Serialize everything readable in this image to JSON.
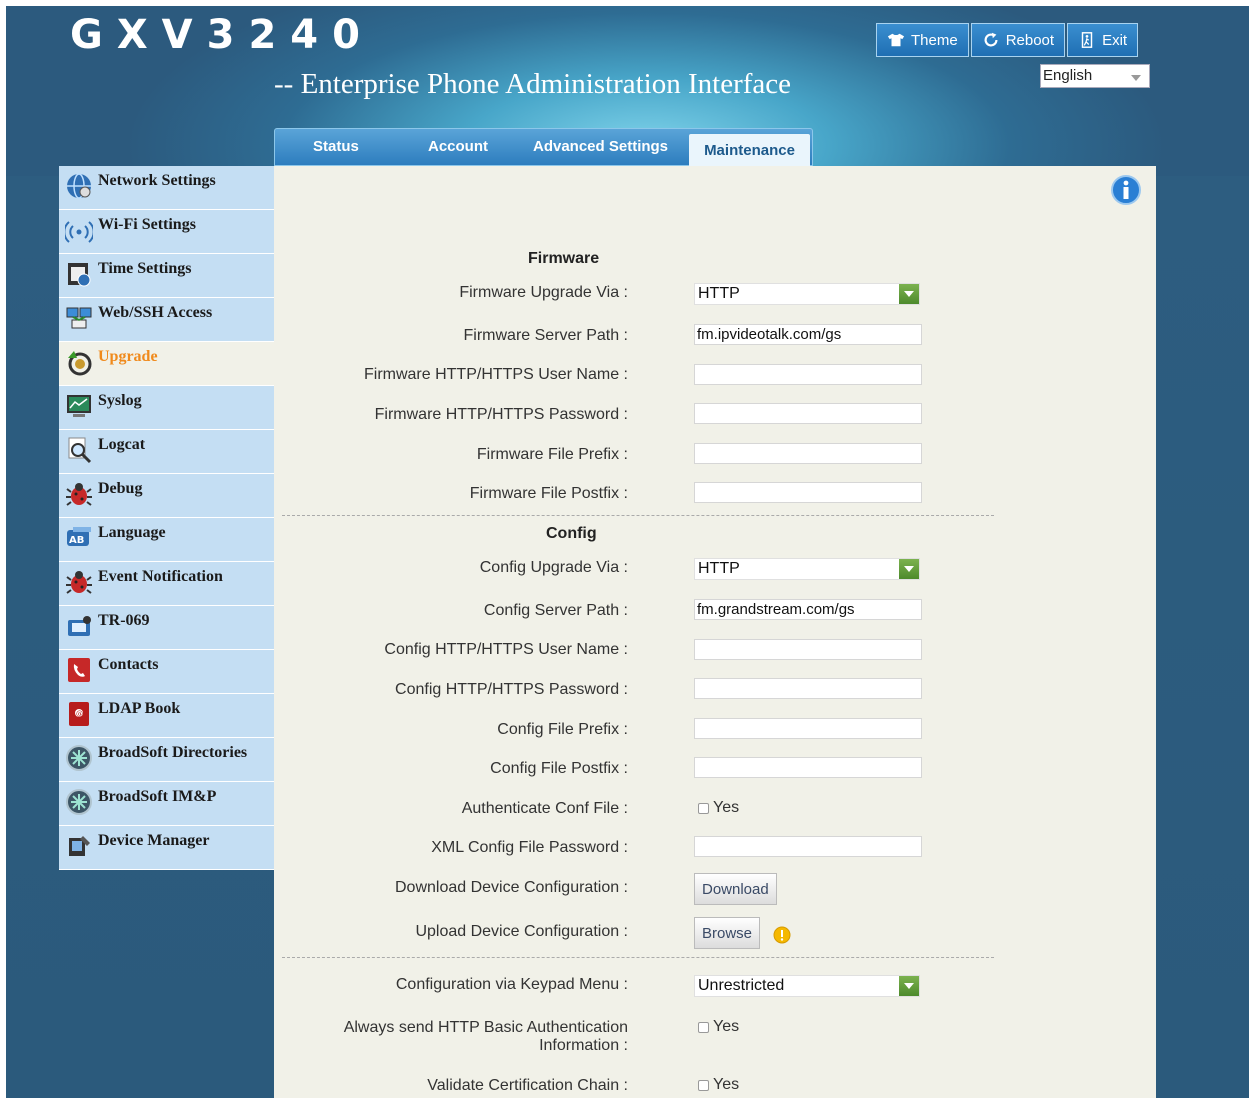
{
  "header": {
    "logo": "GXV3240",
    "subtitle": "-- Enterprise Phone Administration Interface",
    "buttons": {
      "theme": "Theme",
      "reboot": "Reboot",
      "exit": "Exit"
    },
    "language": "English"
  },
  "tabs": [
    "Status",
    "Account",
    "Advanced Settings",
    "Maintenance"
  ],
  "sidebar": [
    {
      "label": "Network Settings",
      "icon": "globe-icon"
    },
    {
      "label": "Wi-Fi Settings",
      "icon": "wifi-icon"
    },
    {
      "label": "Time Settings",
      "icon": "calendar-clock-icon"
    },
    {
      "label": "Web/SSH Access",
      "icon": "network-computers-icon"
    },
    {
      "label": "Upgrade",
      "icon": "upgrade-arrow-icon"
    },
    {
      "label": "Syslog",
      "icon": "monitor-chart-icon"
    },
    {
      "label": "Logcat",
      "icon": "magnifier-document-icon"
    },
    {
      "label": "Debug",
      "icon": "bug-icon"
    },
    {
      "label": "Language",
      "icon": "language-ab-icon"
    },
    {
      "label": "Event Notification",
      "icon": "bug-icon"
    },
    {
      "label": "TR-069",
      "icon": "tr069-device-icon"
    },
    {
      "label": "Contacts",
      "icon": "phone-book-icon"
    },
    {
      "label": "LDAP Book",
      "icon": "ldap-book-icon"
    },
    {
      "label": "BroadSoft Directories",
      "icon": "broadsoft-icon"
    },
    {
      "label": "BroadSoft IM&P",
      "icon": "broadsoft-icon"
    },
    {
      "label": "Device Manager",
      "icon": "device-manager-icon"
    }
  ],
  "firmware": {
    "title": "Firmware",
    "upgrade_via_label": "Firmware Upgrade Via :",
    "upgrade_via_value": "HTTP",
    "server_path_label": "Firmware Server Path :",
    "server_path_value": "fm.ipvideotalk.com/gs",
    "user_label": "Firmware HTTP/HTTPS User Name :",
    "password_label": "Firmware HTTP/HTTPS Password :",
    "prefix_label": "Firmware File Prefix :",
    "postfix_label": "Firmware File Postfix :"
  },
  "config": {
    "title": "Config",
    "upgrade_via_label": "Config Upgrade Via :",
    "upgrade_via_value": "HTTP",
    "server_path_label": "Config Server Path :",
    "server_path_value": "fm.grandstream.com/gs",
    "user_label": "Config HTTP/HTTPS User Name :",
    "password_label": "Config HTTP/HTTPS Password :",
    "prefix_label": "Config File Prefix :",
    "postfix_label": "Config File Postfix :",
    "auth_conf_label": "Authenticate Conf File :",
    "auth_conf_option": "Yes",
    "xml_password_label": "XML Config File Password :",
    "download_label": "Download Device Configuration :",
    "download_button": "Download",
    "upload_label": "Upload Device Configuration :",
    "browse_button": "Browse"
  },
  "misc": {
    "keypad_label": "Configuration via Keypad Menu :",
    "keypad_value": "Unrestricted",
    "basic_auth_label_line1": "Always send HTTP Basic Authentication",
    "basic_auth_label_line2": "Information :",
    "basic_auth_option": "Yes",
    "cert_chain_label": "Validate Certification Chain :",
    "cert_chain_option": "Yes"
  }
}
